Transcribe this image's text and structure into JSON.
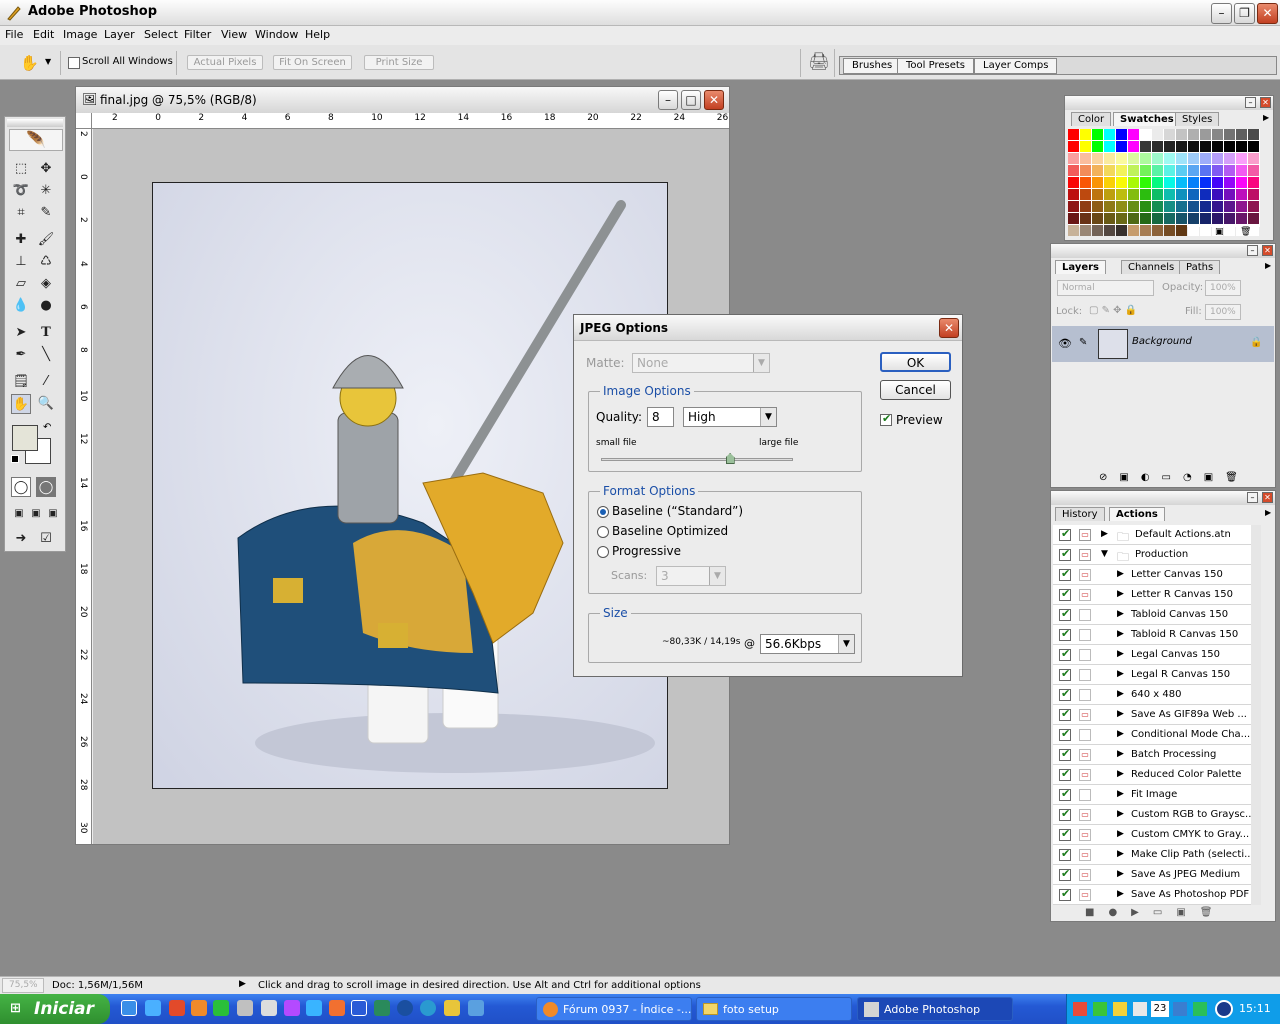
{
  "app": {
    "title": "Adobe Photoshop"
  },
  "menu": [
    "File",
    "Edit",
    "Image",
    "Layer",
    "Select",
    "Filter",
    "View",
    "Window",
    "Help"
  ],
  "options": {
    "scroll_all": "Scroll All Windows",
    "actual_pixels": "Actual Pixels",
    "fit_on_screen": "Fit On Screen",
    "print_size": "Print Size"
  },
  "well_tabs": [
    "Brushes",
    "Tool Presets",
    "Layer Comps"
  ],
  "document": {
    "title": "final.jpg @ 75,5% (RGB/8)",
    "ruler_h": [
      "2",
      "0",
      "2",
      "4",
      "6",
      "8",
      "10",
      "12",
      "14",
      "16",
      "18",
      "20",
      "22",
      "24",
      "26"
    ],
    "ruler_v": [
      "2",
      "0",
      "2",
      "4",
      "6",
      "8",
      "10",
      "12",
      "14",
      "16",
      "18",
      "20",
      "22",
      "24",
      "26",
      "28",
      "30"
    ]
  },
  "jpeg": {
    "title": "JPEG Options",
    "matte_label": "Matte:",
    "matte_value": "None",
    "image_options": "Image Options",
    "quality_label": "Quality:",
    "quality_value": "8",
    "quality_preset": "High",
    "small_file": "small file",
    "large_file": "large file",
    "quality_fraction": 0.67,
    "format_options": "Format Options",
    "baseline_std": "Baseline (“Standard”)",
    "baseline_opt": "Baseline Optimized",
    "progressive": "Progressive",
    "scans_label": "Scans:",
    "scans_value": "3",
    "size_label": "Size",
    "size_info": "~80,33K / 14,19s",
    "at": "@",
    "speed": "56.6Kbps",
    "ok": "OK",
    "cancel": "Cancel",
    "preview": "Preview"
  },
  "swatches_panel": {
    "tabs": [
      "Color",
      "Swatches",
      "Styles"
    ]
  },
  "layers_panel": {
    "tabs": [
      "Layers",
      "Channels",
      "Paths"
    ],
    "blend": "Normal",
    "opacity_label": "Opacity:",
    "opacity": "100%",
    "lock_label": "Lock:",
    "fill_label": "Fill:",
    "fill": "100%",
    "layer_name": "Background"
  },
  "actions_panel": {
    "tabs": [
      "History",
      "Actions"
    ],
    "sets": [
      {
        "name": "Default Actions.atn"
      },
      {
        "name": "Production"
      }
    ],
    "actions": [
      "Letter Canvas 150",
      "Letter R Canvas 150",
      "Tabloid Canvas 150",
      "Tabloid R Canvas 150",
      "Legal Canvas 150",
      "Legal R Canvas 150",
      "640 x 480",
      "Save As GIF89a Web ...",
      "Conditional Mode Cha...",
      "Batch Processing",
      "Reduced Color Palette",
      "Fit Image",
      "Custom RGB to Graysc...",
      "Custom CMYK to Gray...",
      "Make Clip Path (selecti...",
      "Save As JPEG Medium",
      "Save As Photoshop PDF"
    ]
  },
  "status": {
    "zoom": "75,5%",
    "doc": "Doc: 1,56M/1,56M",
    "hint": "Click and drag to scroll image in desired direction.  Use Alt and Ctrl for additional options"
  },
  "taskbar": {
    "start": "Iniciar",
    "tasks": [
      "Fórum 0937 - Índice -...",
      "foto setup",
      "Adobe Photoshop"
    ],
    "clock": "15:11",
    "tray_num": "23"
  }
}
